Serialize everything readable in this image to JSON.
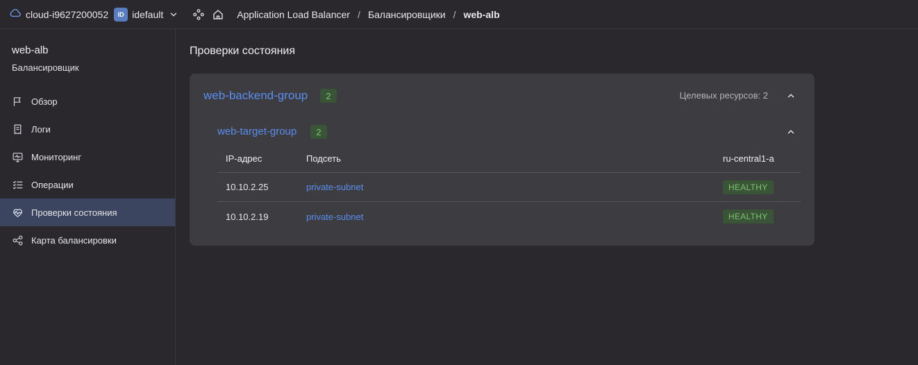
{
  "topbar": {
    "cloud_name": "cloud-i9627200052",
    "folder_badge": "ID",
    "folder_name": "idefault",
    "breadcrumbs": [
      {
        "label": "Application Load Balancer"
      },
      {
        "label": "Балансировщики"
      },
      {
        "label": "web-alb"
      }
    ],
    "separator": "/"
  },
  "sidebar": {
    "title": "web-alb",
    "subtitle": "Балансировщик",
    "items": [
      {
        "label": "Обзор",
        "icon": "flag-icon"
      },
      {
        "label": "Логи",
        "icon": "receipt-icon"
      },
      {
        "label": "Мониторинг",
        "icon": "monitor-icon"
      },
      {
        "label": "Операции",
        "icon": "list-check-icon"
      },
      {
        "label": "Проверки состояния",
        "icon": "heart-pulse-icon",
        "active": true
      },
      {
        "label": "Карта балансировки",
        "icon": "nodes-icon"
      }
    ]
  },
  "main": {
    "title": "Проверки состояния",
    "backend_group": {
      "name": "web-backend-group",
      "count": "2",
      "targets_label": "Целевых ресурсов: 2",
      "target_group": {
        "name": "web-target-group",
        "count": "2",
        "columns": [
          "IP-адрес",
          "Подсеть",
          "ru-central1-a"
        ],
        "rows": [
          {
            "ip": "10.10.2.25",
            "subnet": "private-subnet",
            "status": "HEALTHY"
          },
          {
            "ip": "10.10.2.19",
            "subnet": "private-subnet",
            "status": "HEALTHY"
          }
        ]
      }
    }
  },
  "colors": {
    "background": "#2a282d",
    "card": "#3d3c41",
    "link": "#5b8def",
    "healthy_bg": "#3a5438",
    "healthy_text": "#7fc271",
    "active_nav": "#3b4560"
  }
}
